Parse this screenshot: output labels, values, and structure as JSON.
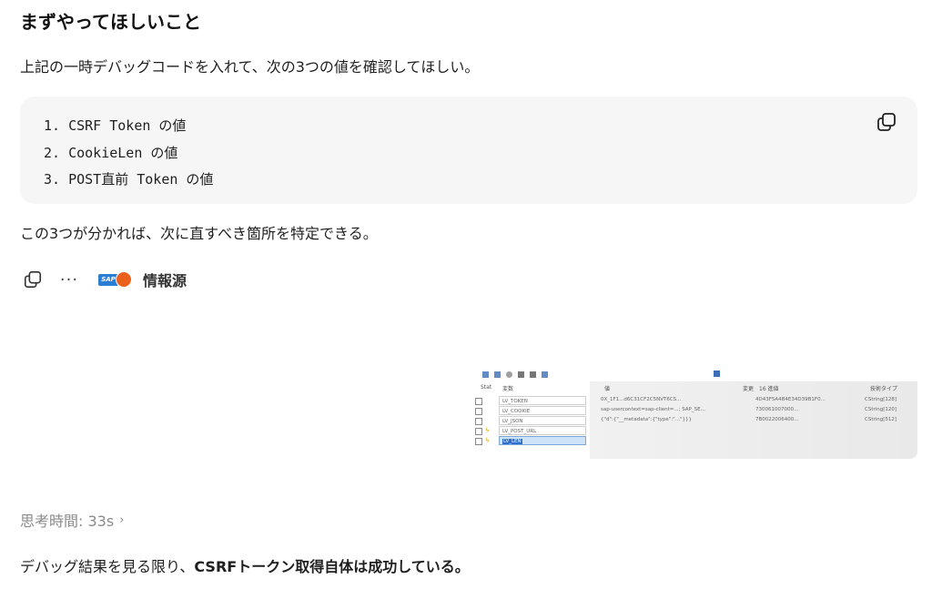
{
  "heading": "まずやってほしいこと",
  "intro": "上記の一時デバッグコードを入れて、次の3つの値を確認してほしい。",
  "code_lines": [
    "1. CSRF Token の値",
    "2. CookieLen の値",
    "3. POST直前 Token の値"
  ],
  "summary": "この3つが分かれば、次に直すべき箇所を特定できる。",
  "actions": {
    "sources_label": "情報源",
    "sap_badge": "SAP"
  },
  "thumbnail": {
    "header": {
      "col1": "Stat",
      "col2": "変数",
      "col3": "値",
      "col4": "変更",
      "col5": "16 進値",
      "col6": "技術タイプ"
    },
    "rows": [
      {
        "name": "LV_TOKEN",
        "val1": "0X_1F1...d6C31CF2C5NVT6CS...",
        "val2": "4D43F5A4B4E34D39B1F0...",
        "type": "CString[128]",
        "bolt": ""
      },
      {
        "name": "LV_COOKIE",
        "val1": "sap-usercontext=sap-client=...; SAP_SE...",
        "val2": "730061007000...",
        "type": "CString[120]",
        "bolt": ""
      },
      {
        "name": "LV_JSON",
        "val1": "{\"d\":{\"__metadata\":{\"type\":\"...\"}}}",
        "val2": "7B0022006400...",
        "type": "CString[512]",
        "bolt": ""
      },
      {
        "name": "LV_POST_URL",
        "val1": "",
        "val2": "",
        "type": "",
        "bolt": "ϟ"
      },
      {
        "name": "LV_LEN",
        "val1": "",
        "val2": "",
        "type": "",
        "bolt": "ϟ"
      }
    ]
  },
  "thinking": {
    "label": "思考時間: 33s",
    "chevron": "›"
  },
  "result": {
    "prefix": "デバッグ結果を見る限り、",
    "bold": "CSRFトークン取得自体は成功している。"
  }
}
